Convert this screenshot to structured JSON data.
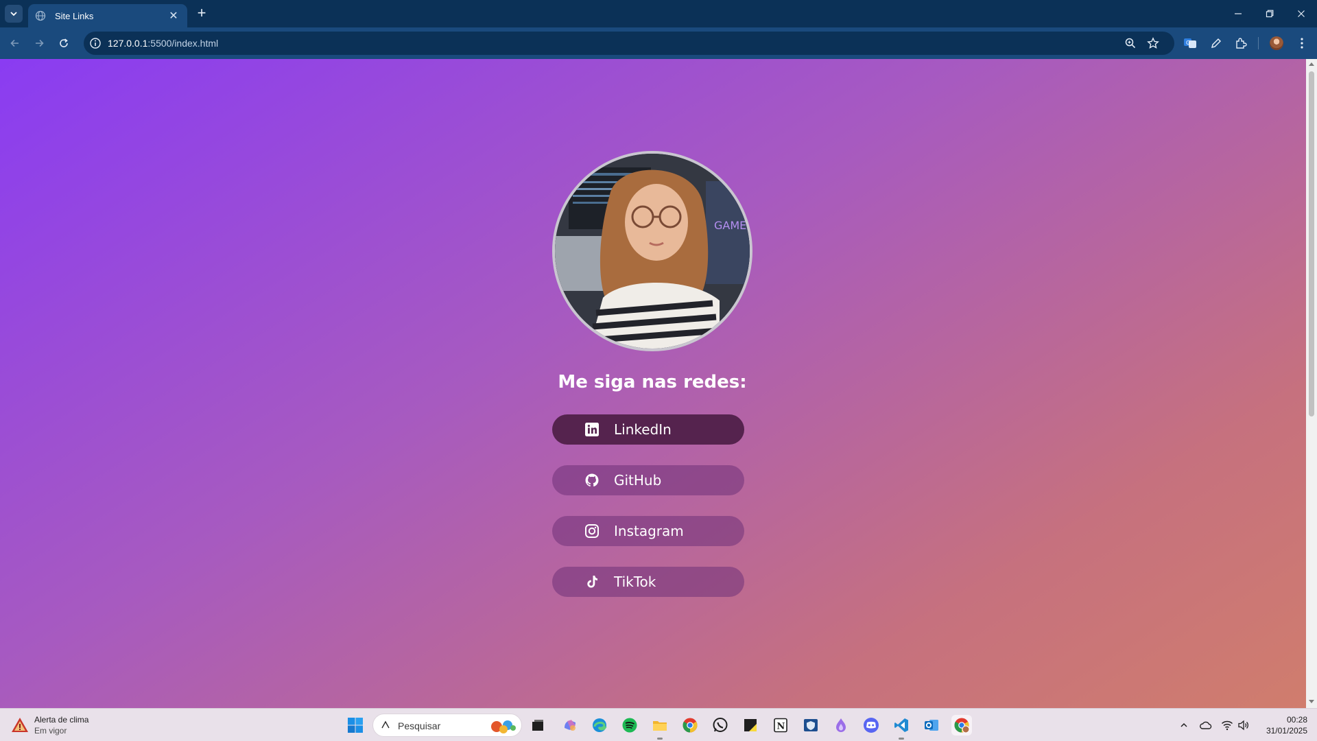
{
  "browser": {
    "tab_title": "Site Links",
    "url_host": "127.0.0.1",
    "url_rest": ":5500/index.html"
  },
  "page": {
    "heading": "Me siga nas redes:",
    "links": [
      {
        "label": "LinkedIn",
        "icon": "linkedin-icon"
      },
      {
        "label": "GitHub",
        "icon": "github-icon"
      },
      {
        "label": "Instagram",
        "icon": "instagram-icon"
      },
      {
        "label": "TikTok",
        "icon": "tiktok-icon"
      }
    ],
    "colors": {
      "gradient_start": "#8a3cf2",
      "gradient_end": "#d07d6d",
      "button_bg": "#8c4b8c",
      "button_active_bg": "#55234e"
    }
  },
  "taskbar": {
    "weather_title": "Alerta de clima",
    "weather_sub": "Em vigor",
    "search_placeholder": "Pesquisar",
    "time": "00:28",
    "date": "31/01/2025"
  }
}
